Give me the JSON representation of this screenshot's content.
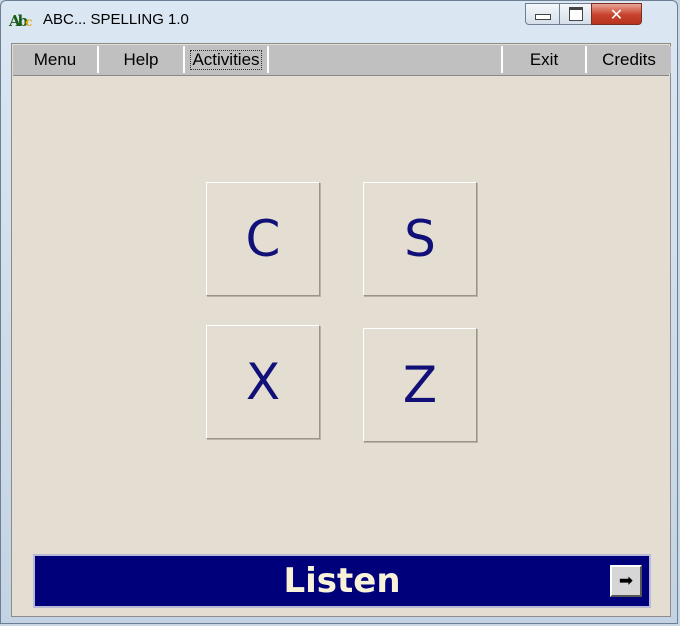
{
  "window": {
    "title": "ABC... SPELLING 1.0",
    "icon_text": "Ab",
    "icon_sub": "c",
    "close_glyph": "✕"
  },
  "menubar": {
    "menu": "Menu",
    "help": "Help",
    "activities": "Activities",
    "exit": "Exit",
    "credits": "Credits"
  },
  "tiles": [
    "C",
    "S",
    "X",
    "Z"
  ],
  "listen_bar": {
    "label": "Listen",
    "arrow": "➡"
  },
  "colors": {
    "client_bg": "#e4ddd1",
    "menubar_bg": "#c0c0c0",
    "letter": "#101078",
    "listen_bg": "#00007a",
    "listen_text": "#f8f3d8"
  }
}
